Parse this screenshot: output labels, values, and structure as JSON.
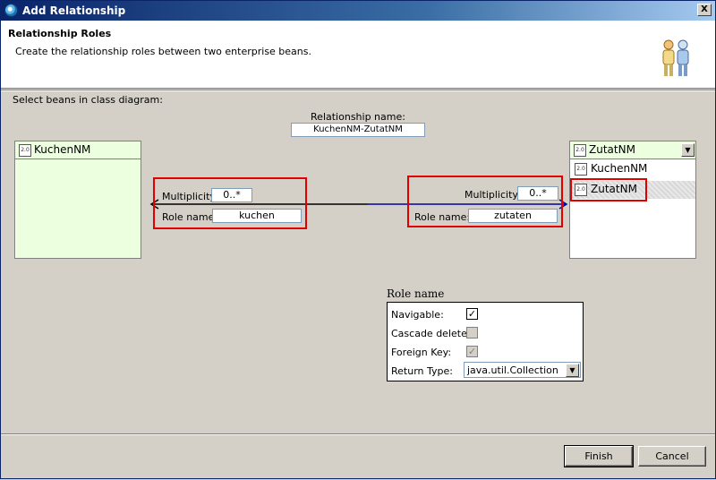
{
  "window": {
    "title": "Add Relationship",
    "close_label": "X"
  },
  "header": {
    "title": "Relationship Roles",
    "description": "Create the relationship roles between two enterprise beans."
  },
  "select_label": "Select beans in class diagram:",
  "relationship": {
    "label": "Relationship name:",
    "value": "KuchenNM-ZutatNM"
  },
  "left_bean": {
    "name": "KuchenNM"
  },
  "right_bean": {
    "selected": "ZutatNM",
    "options": [
      "KuchenNM",
      "ZutatNM"
    ]
  },
  "left_role": {
    "multiplicity_label": "Multiplicity:",
    "multiplicity_value": "0..*",
    "rolename_label": "Role name:",
    "rolename_value": "kuchen"
  },
  "right_role": {
    "multiplicity_label": "Multiplicity:",
    "multiplicity_value": "0..*",
    "rolename_label": "Role name:",
    "rolename_value": "zutaten"
  },
  "role_props": {
    "group_label": "Role name",
    "navigable_label": "Navigable:",
    "navigable_checked": true,
    "cascade_label": "Cascade delete:",
    "cascade_checked": false,
    "foreign_key_label": "Foreign Key:",
    "foreign_key_checked": true,
    "return_type_label": "Return Type:",
    "return_type_value": "java.util.Collection"
  },
  "buttons": {
    "finish": "Finish",
    "cancel": "Cancel"
  },
  "colors": {
    "highlight": "#e00000",
    "arrow_left": "#000000",
    "arrow_right": "#0000a0",
    "bean_bg": "#ecffdf"
  }
}
